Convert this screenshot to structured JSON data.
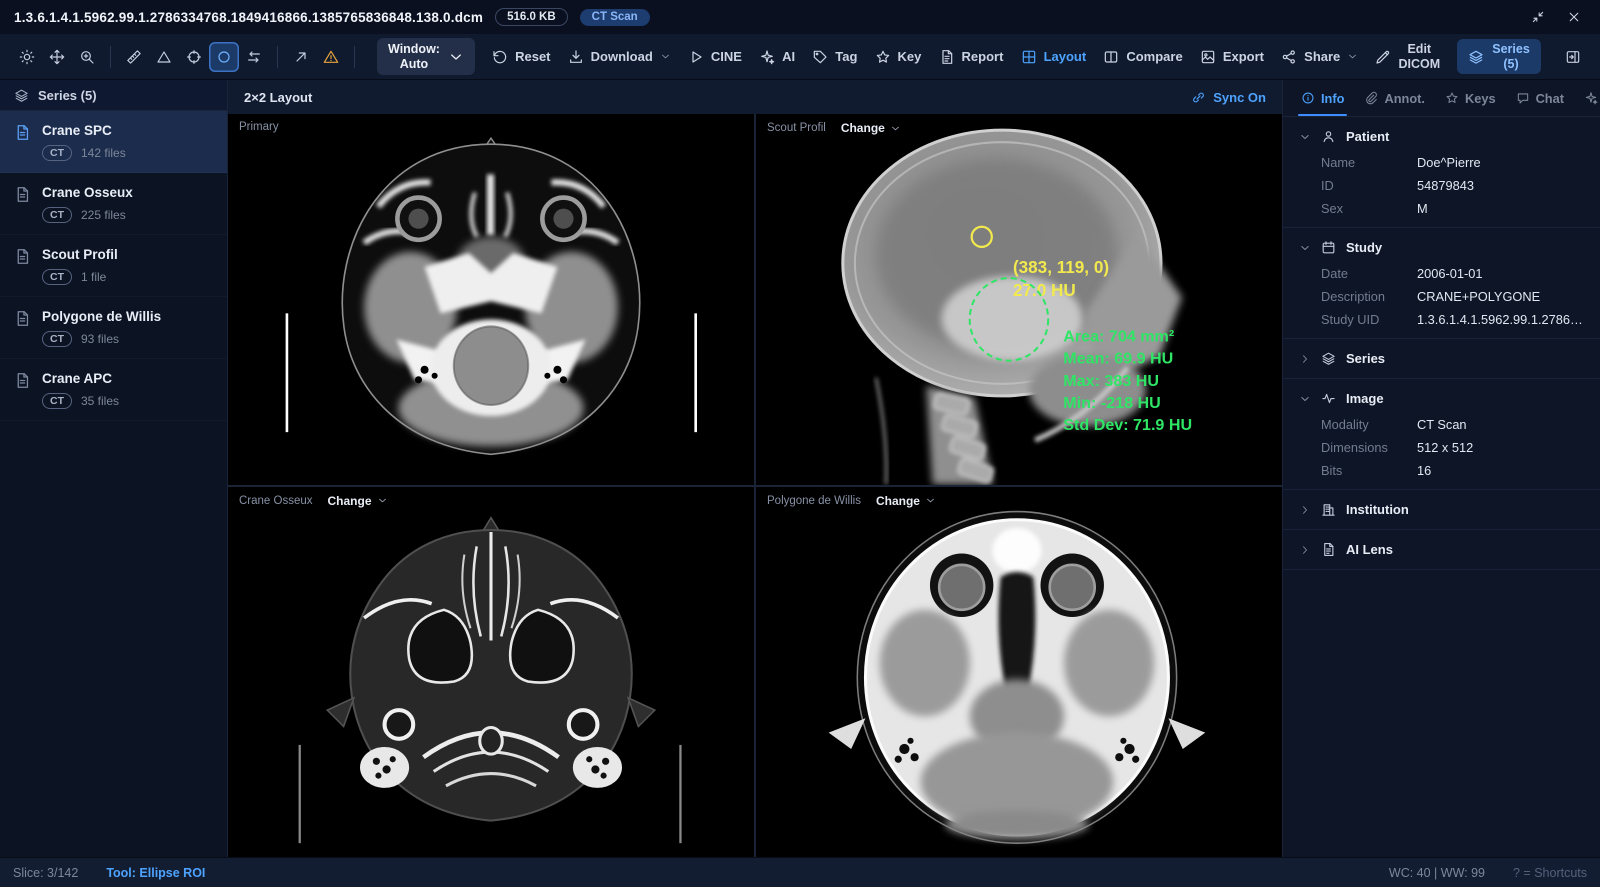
{
  "titlebar": {
    "filename": "1.3.6.1.4.1.5962.99.1.2786334768.1849416866.1385765836848.138.0.dcm",
    "filesize": "516.0 KB",
    "modality": "CT Scan"
  },
  "toolbar": {
    "window_label": "Window:",
    "window_value": "Auto",
    "reset": "Reset",
    "download": "Download",
    "cine": "CINE",
    "ai": "AI",
    "tag": "Tag",
    "key": "Key",
    "report": "Report",
    "layout": "Layout",
    "compare": "Compare",
    "export": "Export",
    "share": "Share",
    "edit_line1": "Edit",
    "edit_line2": "DICOM",
    "series_line1": "Series",
    "series_line2": "(5)"
  },
  "sidebar": {
    "header": "Series (5)",
    "items": [
      {
        "name": "Crane SPC",
        "modality": "CT",
        "count": "142 files",
        "selected": true
      },
      {
        "name": "Crane Osseux",
        "modality": "CT",
        "count": "225 files",
        "selected": false
      },
      {
        "name": "Scout Profil",
        "modality": "CT",
        "count": "1 file",
        "selected": false
      },
      {
        "name": "Polygone de Willis",
        "modality": "CT",
        "count": "93 files",
        "selected": false
      },
      {
        "name": "Crane APC",
        "modality": "CT",
        "count": "35 files",
        "selected": false
      }
    ]
  },
  "main": {
    "layout_label": "2×2 Layout",
    "sync_label": "Sync On",
    "viewports": [
      {
        "label": "Primary"
      },
      {
        "label": "Scout Profil",
        "change": "Change"
      },
      {
        "label": "Crane Osseux",
        "change": "Change"
      },
      {
        "label": "Polygone de Willis",
        "change": "Change"
      }
    ],
    "annotations": {
      "point_coords": "(383, 119, 0)",
      "point_hu": "27.0 HU",
      "roi_area": "Area: 704 mm²",
      "roi_mean": "Mean: 69.9 HU",
      "roi_max": "Max: 383 HU",
      "roi_min": "Min: -218 HU",
      "roi_std": "Std Dev: 71.9 HU"
    }
  },
  "right_panel": {
    "tabs": [
      {
        "label": "Info"
      },
      {
        "label": "Annot."
      },
      {
        "label": "Keys"
      },
      {
        "label": "Chat"
      },
      {
        "label": "AI"
      }
    ],
    "patient": {
      "title": "Patient",
      "rows": [
        {
          "label": "Name",
          "value": "Doe^Pierre"
        },
        {
          "label": "ID",
          "value": "54879843"
        },
        {
          "label": "Sex",
          "value": "M"
        }
      ]
    },
    "study": {
      "title": "Study",
      "rows": [
        {
          "label": "Date",
          "value": "2006-01-01"
        },
        {
          "label": "Description",
          "value": "CRANE+POLYGONE"
        },
        {
          "label": "Study UID",
          "value": "1.3.6.1.4.1.5962.99.1.278633..."
        }
      ]
    },
    "series": {
      "title": "Series"
    },
    "image": {
      "title": "Image",
      "rows": [
        {
          "label": "Modality",
          "value": "CT Scan"
        },
        {
          "label": "Dimensions",
          "value": "512 x 512"
        },
        {
          "label": "Bits",
          "value": "16"
        }
      ]
    },
    "institution": {
      "title": "Institution"
    },
    "ai_lens": {
      "title": "AI Lens"
    }
  },
  "statusbar": {
    "slice": "Slice: 3/142",
    "tool": "Tool: Ellipse ROI",
    "window": "WC: 40 | WW: 99",
    "shortcuts": "? = Shortcuts"
  },
  "colors": {
    "accent": "#4da3ff",
    "annotation_yellow": "#f2e94e",
    "annotation_green": "#2fe565",
    "warning": "#e8a33d",
    "active_button_bg": "#1c3a68"
  }
}
